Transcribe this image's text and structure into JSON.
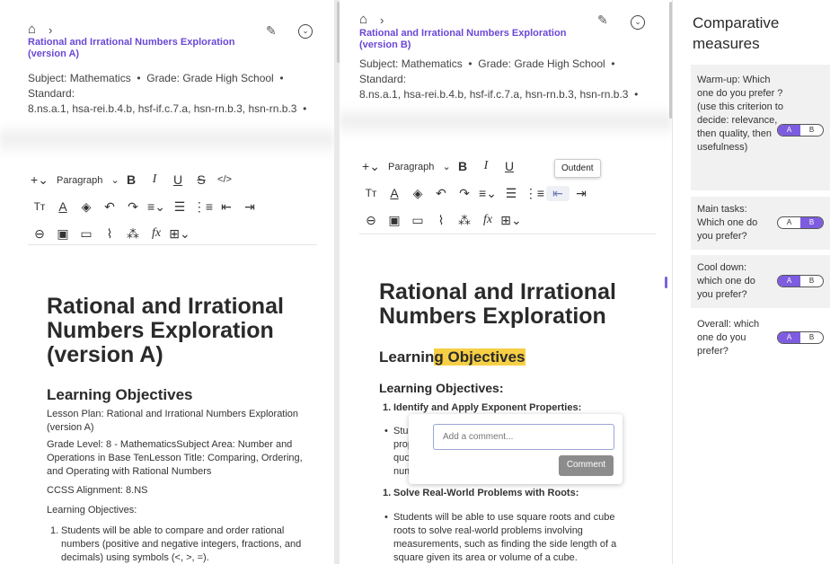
{
  "paneA": {
    "title": "Rational and Irrational Numbers Exploration (version A)",
    "subject_label": "Subject:",
    "subject": "Mathematics",
    "grade_label": "Grade:",
    "grade": "Grade High School",
    "standard_label": "Standard:",
    "standards": "8.ns.a.1, hsa-rei.b.4.b, hsf-if.c.7.a, hsn-rn.b.3, hsn-rn.b.3",
    "paragraph_select": "Paragraph",
    "doc_title": "Rational and Irrational Numbers Exploration (version A)",
    "heading": "Learning Objectives",
    "lines": [
      "Lesson Plan: Rational and Irrational Numbers Exploration (version A)",
      "Grade Level: 8 - MathematicsSubject Area: Number and Operations in Base TenLesson Title: Comparing, Ordering, and Operating with Rational Numbers",
      "CCSS Alignment: 8.NS",
      "Learning Objectives:",
      "Students will be able to compare and order rational numbers (positive and negative integers, fractions, and decimals) using symbols (<, >, =)."
    ]
  },
  "paneB": {
    "title": "Rational and Irrational Numbers Exploration (version B)",
    "subject_label": "Subject:",
    "subject": "Mathematics",
    "grade_label": "Grade:",
    "grade": "Grade High School",
    "standard_label": "Standard:",
    "standards": "8.ns.a.1, hsa-rei.b.4.b, hsf-if.c.7.a, hsn-rn.b.3, hsn-rn.b.3",
    "paragraph_select": "Paragraph",
    "tooltip": "Outdent",
    "doc_title": "Rational and Irrational Numbers Exploration",
    "heading_plain": "Learnin",
    "heading_highlight": "g Objectives",
    "subheading": "Learning Objectives:",
    "item1": "Identify and Apply Exponent Properties:",
    "bullet1_fragments": [
      "Stu",
      "prop",
      "quo",
      "num"
    ],
    "comment_placeholder": "Add a comment...",
    "comment_button": "Comment",
    "item2": "Solve Real-World Problems with Roots:",
    "bullet2": "Students will be able to use square roots and cube roots to solve real-world problems involving measurements, such as finding the side length of a square given its area or volume of a cube."
  },
  "side": {
    "title": "Comparative measures",
    "questions": [
      {
        "text": "Warm-up: Which one do you prefer ? (use this criterion to decide: relevance, then quality, then usefulness)",
        "selected": "A"
      },
      {
        "text": "Main tasks: Which one do you prefer?",
        "selected": "B"
      },
      {
        "text": "Cool down: which one do you prefer?",
        "selected": "A"
      },
      {
        "text": "Overall: which one do you prefer?",
        "selected": "A"
      }
    ],
    "option_a": "A",
    "option_b": "B",
    "accent_color": "#7d5ce0"
  }
}
